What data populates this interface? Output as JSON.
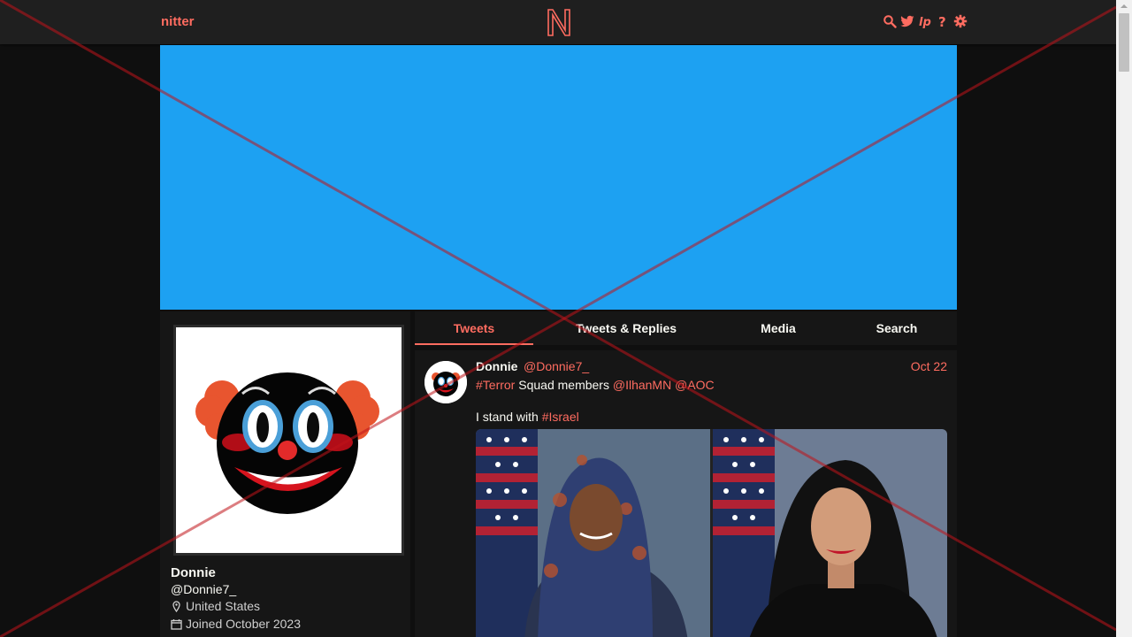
{
  "navbar": {
    "brand": "nitter",
    "logo_letter": "N",
    "icons": [
      "search-icon",
      "twitter-bird-icon",
      "liberapay-icon",
      "help-icon",
      "gear-icon"
    ]
  },
  "banner": {
    "color": "#1da1f2"
  },
  "profile": {
    "fullname": "Donnie",
    "username": "@Donnie7_",
    "location": "United States",
    "joined": "Joined October 2023"
  },
  "tabs": [
    {
      "label": "Tweets",
      "active": true
    },
    {
      "label": "Tweets & Replies",
      "active": false
    },
    {
      "label": "Media",
      "active": false
    },
    {
      "label": "Search",
      "active": false
    }
  ],
  "tweet": {
    "fullname": "Donnie",
    "username": "@Donnie7_",
    "date": "Oct 22",
    "line1": {
      "hashtag": "#Terror",
      "text": " Squad members ",
      "mention1": "@IlhanMN",
      "mention2": "@AOC"
    },
    "line2": {
      "text": "I stand with ",
      "hashtag": "#Israel"
    }
  },
  "colors": {
    "accent": "#ff6c60",
    "background": "#0f0f0f",
    "panel": "#161616",
    "navbar": "#1f1f1f"
  }
}
